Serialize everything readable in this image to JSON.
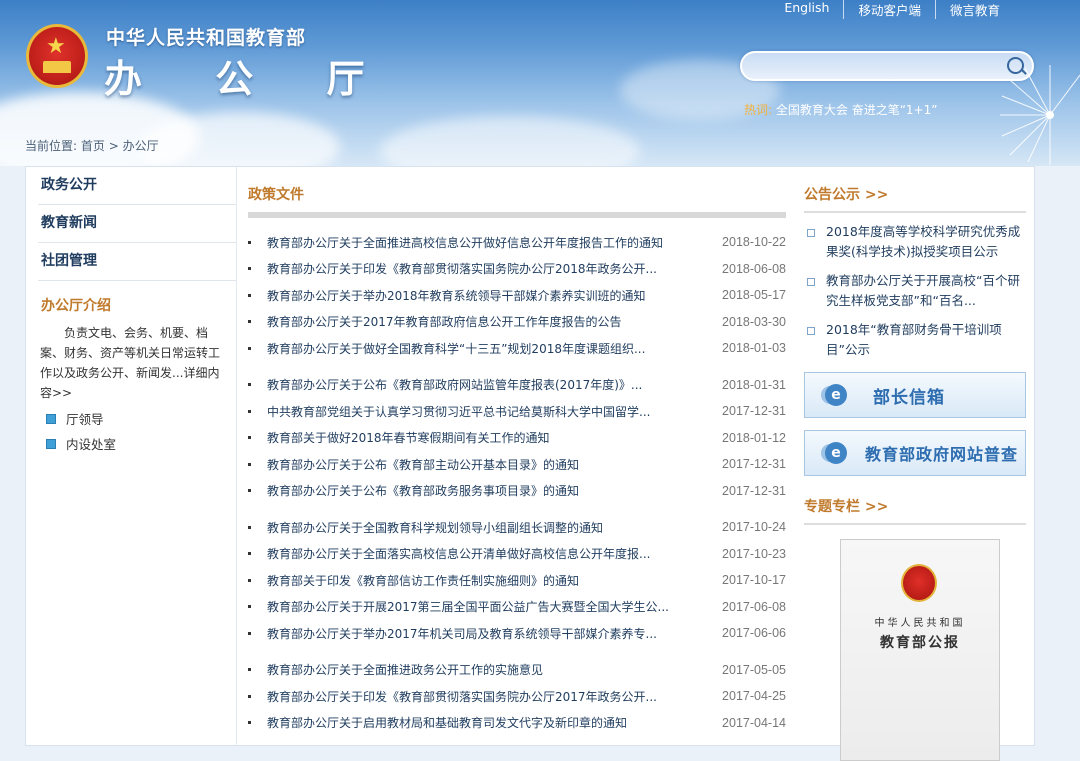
{
  "header": {
    "site_title": "中华人民共和国教育部",
    "office_title": "办 公 厅",
    "top_links": [
      "English",
      "移动客户端",
      "微言教育"
    ],
    "search_placeholder": "",
    "hot_label": "热词:",
    "hot_words": "全国教育大会  奋进之笔“1+1”"
  },
  "breadcrumb": {
    "prefix": "当前位置:",
    "home": "首页",
    "sep": ">",
    "current": "办公厅"
  },
  "left_nav": {
    "items": [
      "政务公开",
      "教育新闻",
      "社团管理"
    ],
    "intro_title": "办公厅介绍",
    "intro_text": "负责文电、会务、机要、档案、财务、资产等机关日常运转工作以及政务公开、新闻发...详细内容>>",
    "sub_items": [
      "厅领导",
      "内设处室"
    ]
  },
  "policy": {
    "title": "政策文件",
    "docs": [
      {
        "title": "教育部办公厅关于全面推进高校信息公开做好信息公开年度报告工作的通知",
        "date": "2018-10-22"
      },
      {
        "title": "教育部办公厅关于印发《教育部贯彻落实国务院办公厅2018年政务公开...",
        "date": "2018-06-08"
      },
      {
        "title": "教育部办公厅关于举办2018年教育系统领导干部媒介素养实训班的通知",
        "date": "2018-05-17"
      },
      {
        "title": "教育部办公厅关于2017年教育部政府信息公开工作年度报告的公告",
        "date": "2018-03-30"
      },
      {
        "title": "教育部办公厅关于做好全国教育科学“十三五”规划2018年度课题组织...",
        "date": "2018-01-03"
      },
      {
        "title": "教育部办公厅关于公布《教育部政府网站监管年度报表(2017年度)》...",
        "date": "2018-01-31"
      },
      {
        "title": "中共教育部党组关于认真学习贯彻习近平总书记给莫斯科大学中国留学...",
        "date": "2017-12-31"
      },
      {
        "title": "教育部关于做好2018年春节寒假期间有关工作的通知",
        "date": "2018-01-12"
      },
      {
        "title": "教育部办公厅关于公布《教育部主动公开基本目录》的通知",
        "date": "2017-12-31"
      },
      {
        "title": "教育部办公厅关于公布《教育部政务服务事项目录》的通知",
        "date": "2017-12-31"
      },
      {
        "title": "教育部办公厅关于全国教育科学规划领导小组副组长调整的通知",
        "date": "2017-10-24"
      },
      {
        "title": "教育部办公厅关于全面落实高校信息公开清单做好高校信息公开年度报...",
        "date": "2017-10-23"
      },
      {
        "title": "教育部关于印发《教育部信访工作责任制实施细则》的通知",
        "date": "2017-10-17"
      },
      {
        "title": "教育部办公厅关于开展2017第三届全国平面公益广告大赛暨全国大学生公...",
        "date": "2017-06-08"
      },
      {
        "title": "教育部办公厅关于举办2017年机关司局及教育系统领导干部媒介素养专...",
        "date": "2017-06-06"
      },
      {
        "title": "教育部办公厅关于全面推进政务公开工作的实施意见",
        "date": "2017-05-05"
      },
      {
        "title": "教育部办公厅关于印发《教育部贯彻落实国务院办公厅2017年政务公开...",
        "date": "2017-04-25"
      },
      {
        "title": "教育部办公厅关于启用教材局和基础教育司发文代字及新印章的通知",
        "date": "2017-04-14"
      }
    ]
  },
  "right": {
    "notice_title": "公告公示 >>",
    "notices": [
      "2018年度高等学校科学研究优秀成果奖(科学技术)拟授奖项目公示",
      "教育部办公厅关于开展高校“百个研究生样板党支部”和“百名...",
      "2018年“教育部财务骨干培训项目”公示"
    ],
    "banner1": "部长信箱",
    "banner2": "教育部政府网站普查",
    "special_title": "专题专栏 >>",
    "journal_line1": "中华人民共和国",
    "journal_line2": "教育部公报"
  },
  "colors": {
    "accent": "#c07a2c",
    "link": "#1f3c5e",
    "header_blue": "#5f9ad6"
  }
}
